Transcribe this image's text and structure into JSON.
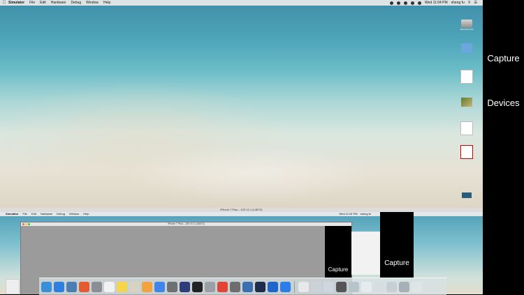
{
  "menubar": {
    "items": [
      "Simulator",
      "File",
      "Edit",
      "Hardware",
      "Debug",
      "Window",
      "Help"
    ],
    "clock": "Wed 11:04 PM",
    "user": "sheng fu"
  },
  "desktop": {
    "icons": [
      {
        "name": "disk-icon",
        "label": "Macintosh HD",
        "kind": "disk"
      },
      {
        "name": "folder-icon",
        "label": "",
        "kind": "folder"
      },
      {
        "name": "document-icon",
        "label": "",
        "kind": "doc"
      },
      {
        "name": "photo-icon",
        "label": "",
        "kind": "photo"
      },
      {
        "name": "blank-document-icon",
        "label": "",
        "kind": "doc"
      },
      {
        "name": "pdf-icon",
        "label": "",
        "kind": "pdf"
      },
      {
        "name": "screenshot-icon",
        "label": "",
        "kind": "small"
      }
    ]
  },
  "inner": {
    "title": "iPhone 7 Plus – iOS 10.1 (14B72)",
    "window_title": "iPhone 7 Plus – iOS 10.1 (14B72)",
    "menubar": [
      "Simulator",
      "File",
      "Edit",
      "Hardware",
      "Debug",
      "Window",
      "Help"
    ],
    "clock": "Wed 11:04 PM",
    "user": "sheng fu"
  },
  "phones": {
    "small_label": "Capture",
    "mid_label": "Capture"
  },
  "side": {
    "capture_label": "Capture",
    "devices_label": "Devices"
  },
  "dock": {
    "colors": [
      "#3a8fd9",
      "#2d7fe0",
      "#4a7fb5",
      "#e45b2f",
      "#8a8f96",
      "#f2f2f2",
      "#f7d54b",
      "#d8d2c2",
      "#f3a33b",
      "#3f86e8",
      "#6e7072",
      "#2e3d7a",
      "#222222",
      "#9aa0a6",
      "#e04434",
      "#6d6d6d",
      "#3c6fb0",
      "#1f2d4d",
      "#1e66c9",
      "#2b7de9",
      "#e8e8e8",
      "#ccd3d8",
      "#cfd6dd",
      "#555555",
      "#b8c4cc",
      "#e6ebef",
      "#d8dde1",
      "#c8cfd4",
      "#a6b0b8",
      "#dfe4e7"
    ]
  }
}
